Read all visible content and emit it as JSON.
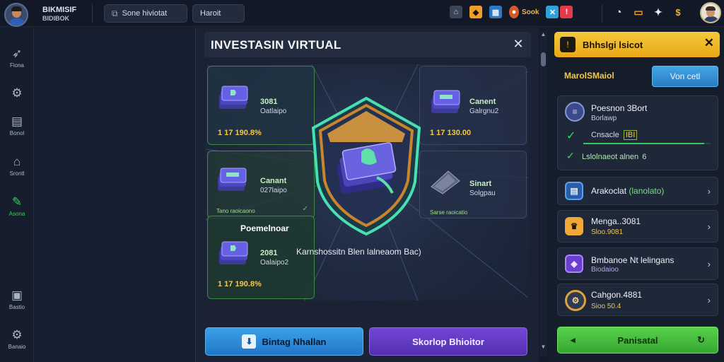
{
  "app": {
    "brand_line1": "BIKMISIF",
    "brand_line2": "BIDIBOK"
  },
  "topbar": {
    "tab1_label": "Sone hiviotat",
    "tab2_label": "Haroit",
    "sook_label": "Sook"
  },
  "sidebar": {
    "items": [
      {
        "label": "Fiona",
        "icon": "chart-icon"
      },
      {
        "label": "",
        "icon": "gear-icon"
      },
      {
        "label": "Bonol",
        "icon": "document-icon"
      },
      {
        "label": "Srontl",
        "icon": "home-icon"
      },
      {
        "label": "Asona",
        "icon": "edit-icon"
      },
      {
        "label": "Bastio",
        "icon": "clipboard-icon"
      },
      {
        "label": "Banaio",
        "icon": "settings-icon"
      }
    ]
  },
  "modal": {
    "title": "INVESTASIN VIRTUAL",
    "cards": [
      {
        "title": "3081",
        "sub": "Oatlaipo",
        "value": "1 17 190.8%"
      },
      {
        "title": "Canent",
        "sub": "Galrgnu2",
        "value": "1 17 130.00"
      },
      {
        "title": "Canant",
        "sub": "027laipo",
        "value": "",
        "foot": "Tano raoicaono"
      },
      {
        "title": "Sinart",
        "sub": "Solgpau",
        "value": "",
        "foot": "Sarse raoicatio"
      },
      {
        "title": "2081",
        "sub": "Oalaipo2",
        "value": "1 17 190.8%"
      }
    ],
    "pre_label": "Poemelnoar",
    "caption": "Karnshossitn Blen lalneaom Bac)",
    "btn_left": "Bintag Nhallan",
    "btn_right": "Skorlop Bhioitor"
  },
  "right_panel": {
    "header": "Bhhslgi lsicot",
    "tab1": "MarolSMaiol",
    "tab2": "Von cetl",
    "profile": {
      "name": "Poesnon 3Bort",
      "sub": "Borlawp",
      "check1": "Cnsacle",
      "check1_badge": "IBI",
      "check2": "Lslolnaeot alnen",
      "check2_badge": "6",
      "progress": 0.95
    },
    "items": [
      {
        "title": "Arakoclat",
        "sub": "(lanolato)",
        "icon": "document-icon",
        "color": "#3b8be6"
      },
      {
        "title": "Menga..3081",
        "sub": "Sloo.9081",
        "icon": "trophy-icon",
        "color": "#f0a83a"
      },
      {
        "title": "Bmbanoe Nt lelingans",
        "sub": "Biodaioo",
        "icon": "shield-icon",
        "color": "#8a5ae0"
      },
      {
        "title": "Cahgon.4881",
        "sub": "Sioo 50.4",
        "icon": "gear-icon",
        "color": "#e0a33a"
      }
    ],
    "bottom_button": "Panisatal"
  },
  "colors": {
    "accent_green": "#38d05e",
    "accent_gold": "#f2c64a",
    "accent_blue": "#3aa0e8",
    "accent_purple": "#6a3fd0"
  }
}
